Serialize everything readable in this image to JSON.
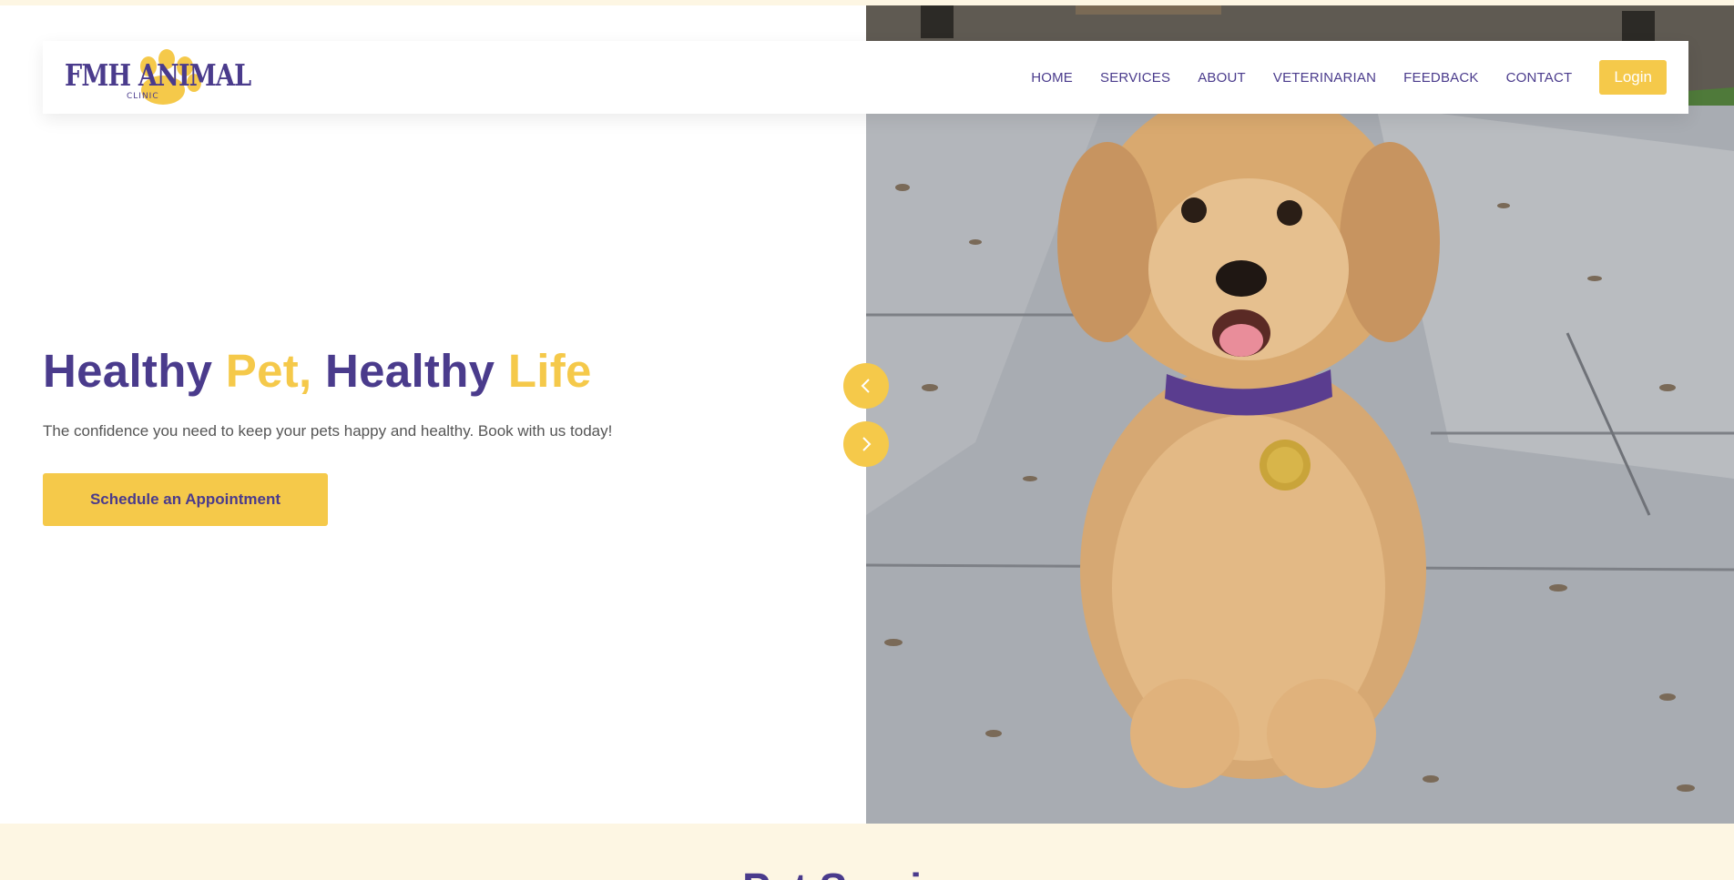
{
  "brand": {
    "logo_text": "FMH ANIMAL",
    "logo_sub": "CLINIC"
  },
  "nav": {
    "items": [
      {
        "label": "HOME"
      },
      {
        "label": "SERVICES"
      },
      {
        "label": "ABOUT"
      },
      {
        "label": "VETERINARIAN"
      },
      {
        "label": "FEEDBACK"
      },
      {
        "label": "CONTACT"
      }
    ],
    "login_label": "Login"
  },
  "hero": {
    "title_part1": "Healthy ",
    "title_part2": "Pet,",
    "title_part3": " Healthy ",
    "title_part4": "Life",
    "subtitle": "The confidence you need to keep your pets happy and healthy. Book with us today!",
    "cta_label": "Schedule an Appointment",
    "image_subject": "golden retriever puppy on stone pathway"
  },
  "carousel": {
    "prev_icon": "chevron-left-icon",
    "next_icon": "chevron-right-icon"
  },
  "next_section": {
    "title": "Pet Services"
  },
  "colors": {
    "brand_purple": "#4a3b8c",
    "brand_yellow": "#f5c94a",
    "cream": "#fdf6e3"
  }
}
